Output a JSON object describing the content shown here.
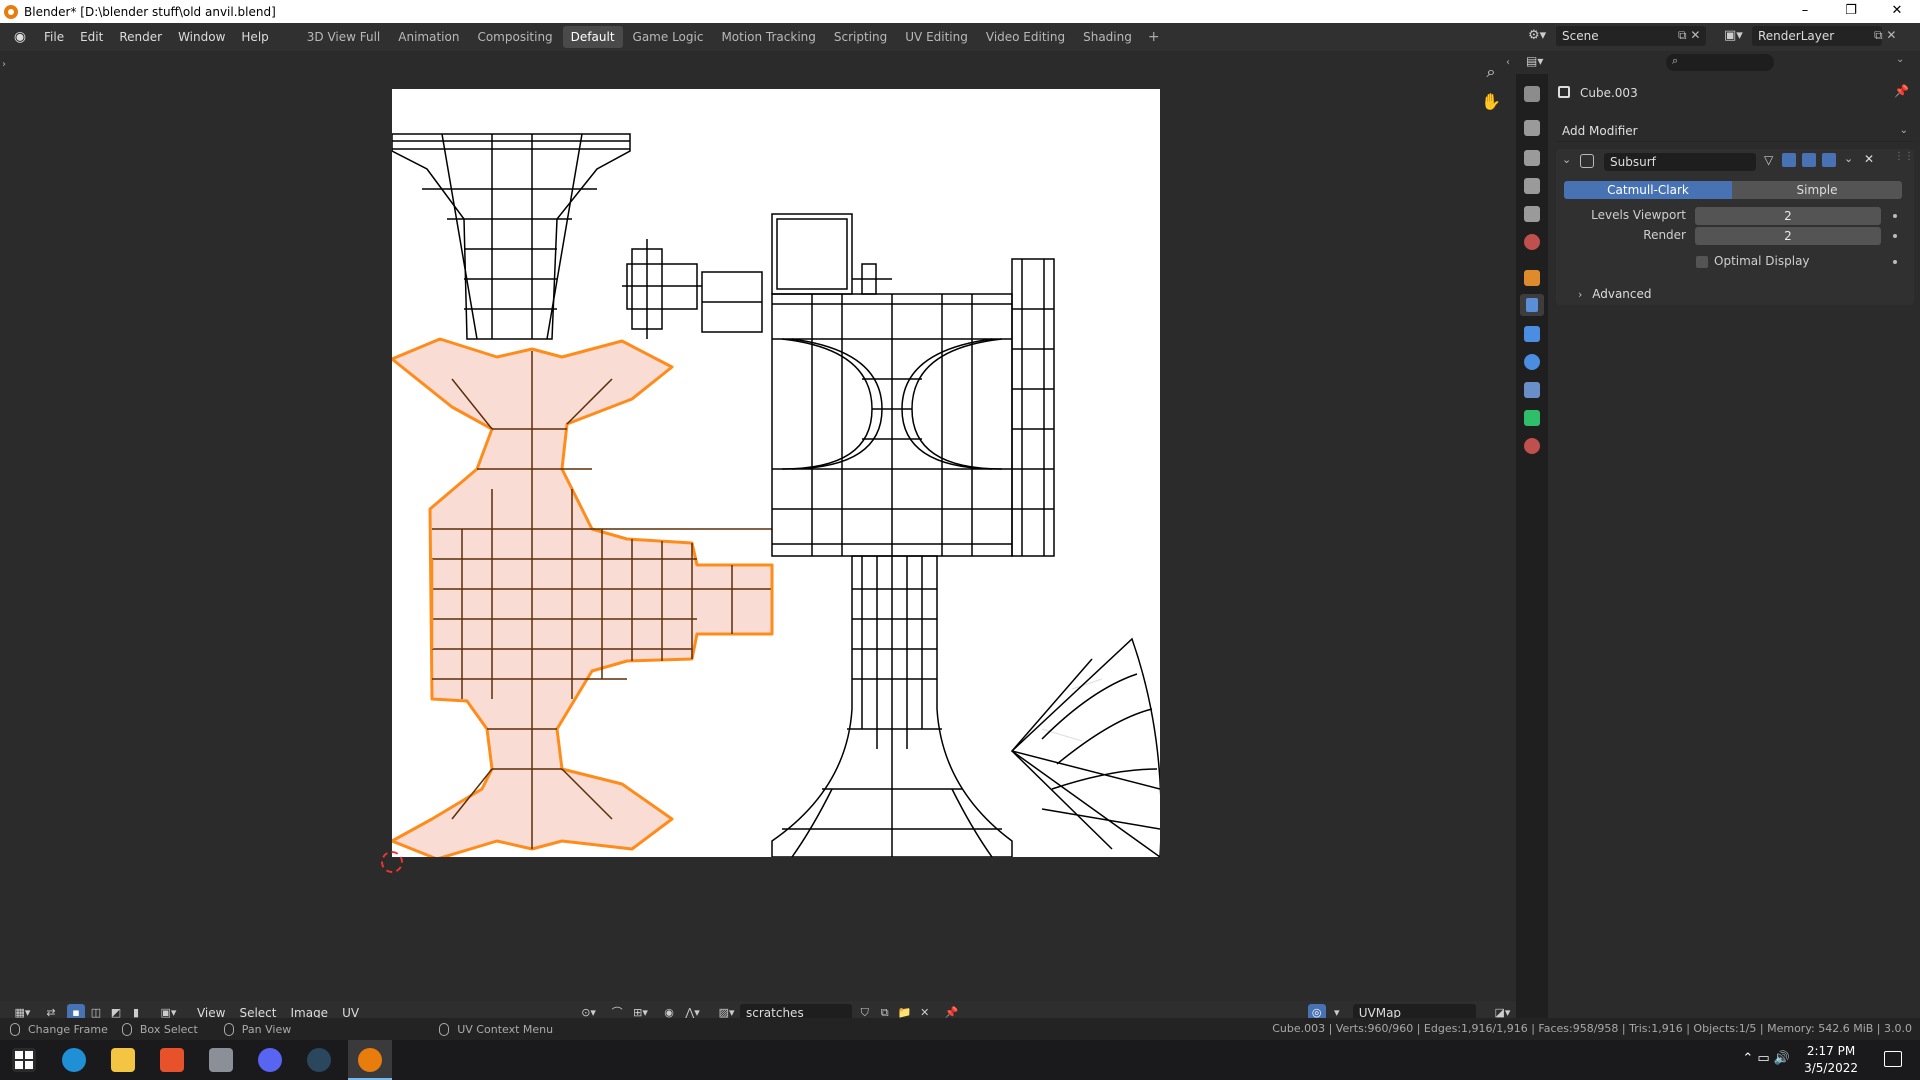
{
  "window": {
    "title": "Blender* [D:\\blender stuff\\old anvil.blend]",
    "minimize": "–",
    "restore": "❐",
    "close": "✕"
  },
  "menus": [
    "File",
    "Edit",
    "Render",
    "Window",
    "Help"
  ],
  "workspaces": [
    {
      "label": "3D View Full",
      "active": false
    },
    {
      "label": "Animation",
      "active": false
    },
    {
      "label": "Compositing",
      "active": false
    },
    {
      "label": "Default",
      "active": true
    },
    {
      "label": "Game Logic",
      "active": false
    },
    {
      "label": "Motion Tracking",
      "active": false
    },
    {
      "label": "Scripting",
      "active": false
    },
    {
      "label": "UV Editing",
      "active": false
    },
    {
      "label": "Video Editing",
      "active": false
    },
    {
      "label": "Shading",
      "active": false
    }
  ],
  "add_workspace": "+",
  "scene": {
    "name": "Scene",
    "render_layer": "RenderLayer"
  },
  "uv_header": {
    "menus": [
      "View",
      "Select",
      "Image",
      "UV"
    ],
    "image_name": "scratches",
    "uv_map": "UVMap"
  },
  "properties": {
    "object_name": "Cube.003",
    "add_modifier": "Add Modifier",
    "modifier": {
      "name": "Subsurf",
      "mode_options": [
        "Catmull-Clark",
        "Simple"
      ],
      "active_mode": "Catmull-Clark",
      "levels_viewport_label": "Levels Viewport",
      "levels_viewport": "2",
      "render_label": "Render",
      "render": "2",
      "optimal_display_label": "Optimal Display",
      "optimal_display": false,
      "advanced_label": "Advanced"
    }
  },
  "status": {
    "items": [
      {
        "label": "Change Frame"
      },
      {
        "label": "Box Select"
      },
      {
        "label": "Pan View"
      },
      {
        "label": "UV Context Menu"
      }
    ],
    "stats": "Cube.003 | Verts:960/960 | Edges:1,916/1,916 | Faces:958/958 | Tris:1,916 | Objects:1/5 | Memory: 542.6 MiB | 3.0.0"
  },
  "taskbar": {
    "time": "2:17 PM",
    "date": "3/5/2022"
  },
  "colors": {
    "selected_edge": "#ff8c1a",
    "selected_face": "#f9dcd4",
    "unselected_edge": "#000000",
    "accent": "#4772b3"
  }
}
